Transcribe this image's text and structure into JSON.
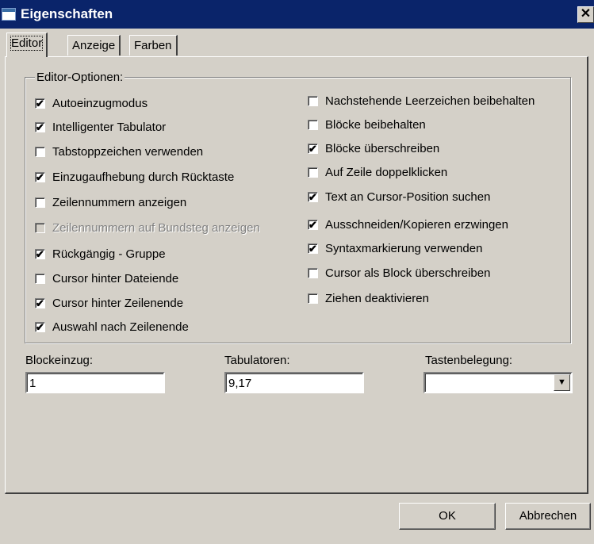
{
  "window": {
    "title": "Eigenschaften",
    "close_glyph": "✕"
  },
  "tabs": [
    {
      "label": "Editor",
      "active": true
    },
    {
      "label": "Anzeige",
      "active": false
    },
    {
      "label": "Farben",
      "active": false
    }
  ],
  "group": {
    "legend": "Editor-Optionen:"
  },
  "left_options": [
    {
      "label": "Autoeinzugmodus",
      "checked": true,
      "enabled": true
    },
    {
      "label": "Intelligenter Tabulator",
      "checked": true,
      "enabled": true
    },
    {
      "label": "Tabstoppzeichen verwenden",
      "checked": false,
      "enabled": true
    },
    {
      "label": "Einzugaufhebung durch Rücktaste",
      "checked": true,
      "enabled": true
    },
    {
      "label": "Zeilennummern anzeigen",
      "checked": false,
      "enabled": true
    },
    {
      "label": "Zeilennummern auf Bundsteg anzeigen",
      "checked": false,
      "enabled": false
    },
    {
      "label": "Rückgängig - Gruppe",
      "checked": true,
      "enabled": true
    },
    {
      "label": "Cursor hinter Dateiende",
      "checked": false,
      "enabled": true
    },
    {
      "label": "Cursor hinter Zeilenende",
      "checked": true,
      "enabled": true
    },
    {
      "label": "Auswahl nach Zeilenende",
      "checked": true,
      "enabled": true
    }
  ],
  "right_options": [
    {
      "label": "Nachstehende Leerzeichen beibehalten",
      "checked": false,
      "enabled": true
    },
    {
      "label": "Blöcke beibehalten",
      "checked": false,
      "enabled": true
    },
    {
      "label": "Blöcke überschreiben",
      "checked": true,
      "enabled": true
    },
    {
      "label": "Auf Zeile doppelklicken",
      "checked": false,
      "enabled": true
    },
    {
      "label": "Text an Cursor-Position suchen",
      "checked": true,
      "enabled": true
    },
    {
      "label": "Ausschneiden/Kopieren erzwingen",
      "checked": true,
      "enabled": true
    },
    {
      "label": "Syntaxmarkierung verwenden",
      "checked": true,
      "enabled": true
    },
    {
      "label": "Cursor als Block überschreiben",
      "checked": false,
      "enabled": true
    },
    {
      "label": "Ziehen deaktivieren",
      "checked": false,
      "enabled": true
    }
  ],
  "fields": {
    "block_indent": {
      "label": "Blockeinzug:",
      "value": "1"
    },
    "tab_stops": {
      "label": "Tabulatoren:",
      "value": "9,17"
    },
    "keymap": {
      "label": "Tastenbelegung:",
      "value": "",
      "arrow_glyph": "▼"
    }
  },
  "buttons": {
    "ok": "OK",
    "cancel": "Abbrechen"
  },
  "check_glyph": "✔"
}
